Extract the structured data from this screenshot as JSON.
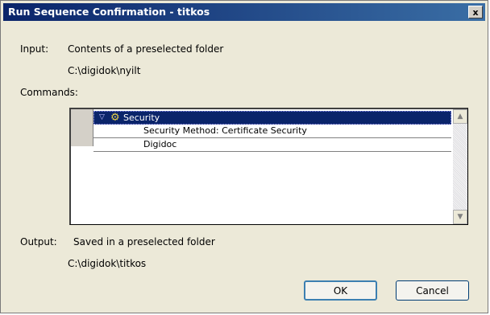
{
  "window": {
    "title": "Run Sequence Confirmation - titkos",
    "close_glyph": "x"
  },
  "input": {
    "label": "Input:",
    "description": "Contents of a preselected folder",
    "path": "C:\\digidok\\nyilt"
  },
  "commands": {
    "label": "Commands:",
    "items": [
      {
        "label": "Security",
        "icon": "gear-icon",
        "selected": true,
        "expanded": true
      },
      {
        "label": "Security Method: Certificate Security"
      },
      {
        "label": "Digidoc"
      }
    ]
  },
  "output": {
    "label": "Output:",
    "description": "Saved in a preselected folder",
    "path": "C:\\digidok\\titkos"
  },
  "buttons": {
    "ok": "OK",
    "cancel": "Cancel"
  },
  "colors": {
    "title_bar": "#0a246a",
    "selection": "#0a246a",
    "dialog_bg": "#ece9d8"
  }
}
